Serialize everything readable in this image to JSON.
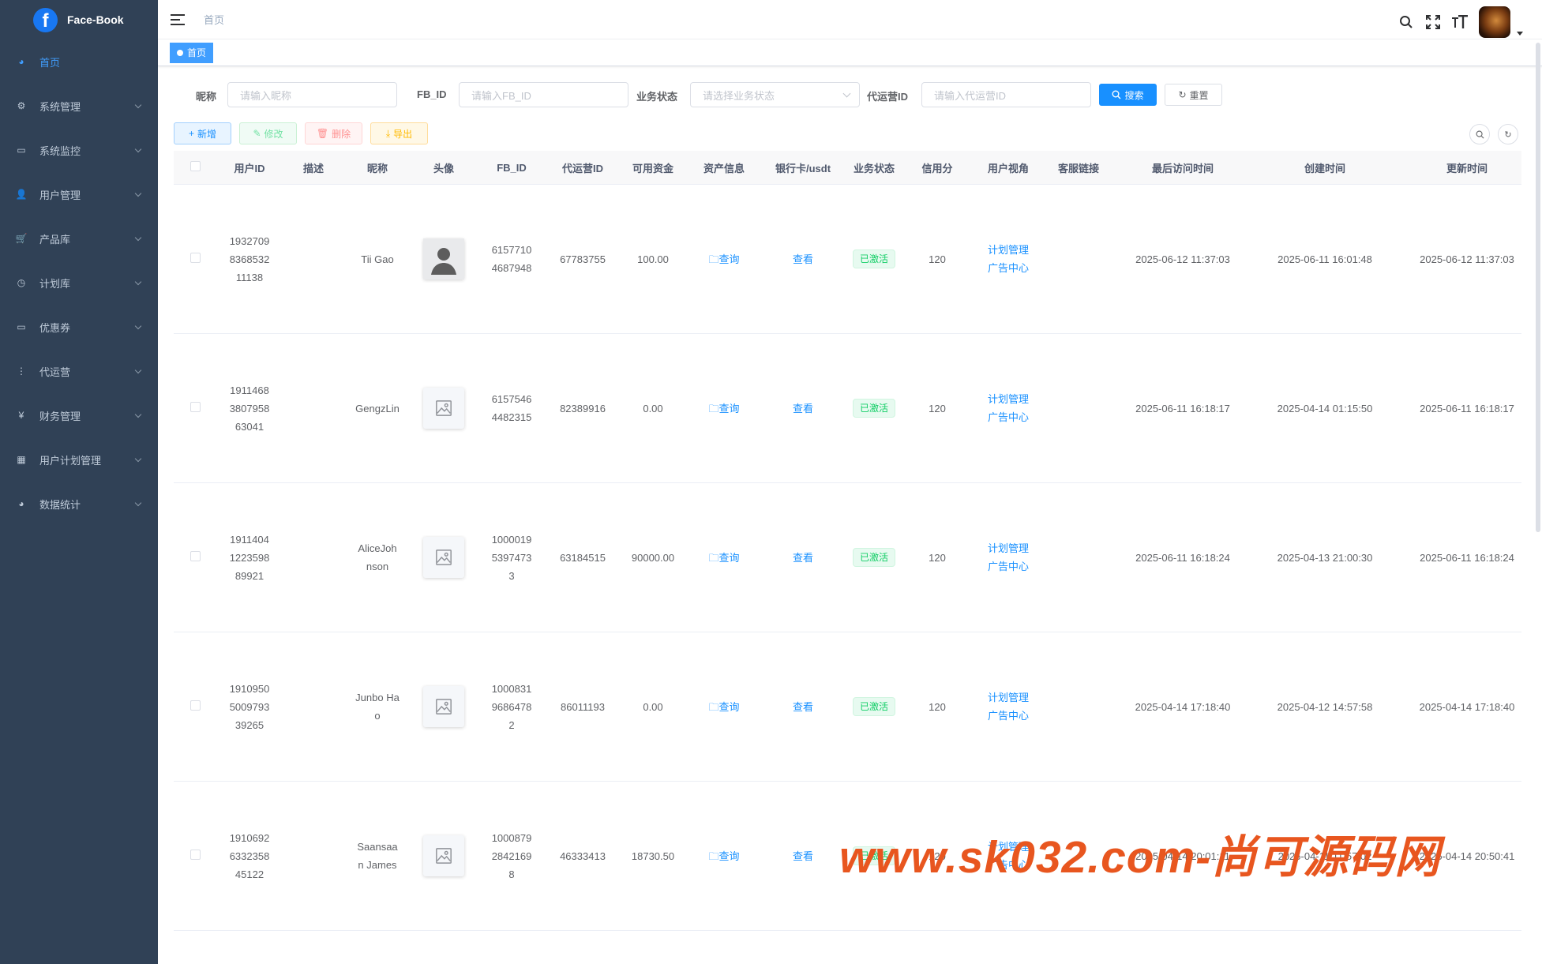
{
  "brand": {
    "title": "Face-Book",
    "logo_letter": "f",
    "accent": "#409eff"
  },
  "sidebar": {
    "items": [
      {
        "label": "首页",
        "icon": "dashboard-icon",
        "active": true
      },
      {
        "label": "系统管理",
        "icon": "gear-icon"
      },
      {
        "label": "系统监控",
        "icon": "monitor-icon"
      },
      {
        "label": "用户管理",
        "icon": "users-icon"
      },
      {
        "label": "产品库",
        "icon": "cart-icon"
      },
      {
        "label": "计划库",
        "icon": "clock-icon"
      },
      {
        "label": "优惠券",
        "icon": "coupon-icon"
      },
      {
        "label": "代运营",
        "icon": "tree-icon"
      },
      {
        "label": "财务管理",
        "icon": "yen-icon"
      },
      {
        "label": "用户计划管理",
        "icon": "grid-icon"
      },
      {
        "label": "数据统计",
        "icon": "chart-icon"
      }
    ]
  },
  "navbar": {
    "breadcrumb": "首页"
  },
  "tags": {
    "active_tag": "首页"
  },
  "search": {
    "nickname_label": "昵称",
    "nickname_placeholder": "请输入昵称",
    "fbid_label": "FB_ID",
    "fbid_placeholder": "请输入FB_ID",
    "status_label": "业务状态",
    "status_placeholder": "请选择业务状态",
    "agent_label": "代运营ID",
    "agent_placeholder": "请输入代运营ID",
    "search_button": "搜索",
    "reset_button": "重置"
  },
  "toolbar": {
    "add": "新增",
    "edit": "修改",
    "delete": "删除",
    "export": "导出"
  },
  "table": {
    "columns": [
      "",
      "用户ID",
      "描述",
      "昵称",
      "头像",
      "FB_ID",
      "代运营ID",
      "可用资金",
      "资产信息",
      "银行卡/usdt",
      "业务状态",
      "信用分",
      "用户视角",
      "客服链接",
      "最后访问时间",
      "创建时间",
      "更新时间"
    ],
    "rows": [
      {
        "user_id": [
          "1932709",
          "8368532",
          "11138"
        ],
        "desc": "",
        "nickname": [
          "Tii Gao"
        ],
        "avatar": "person",
        "fb_id": [
          "6157710",
          "4687948"
        ],
        "agent_id": "67783755",
        "funds": "100.00",
        "asset": "查询",
        "bank": "查看",
        "status": "已激活",
        "credit": "120",
        "view1": "计划管理",
        "view2": "广告中心",
        "service": "",
        "last_visit": "2025-06-12 11:37:03",
        "created": "2025-06-11 16:01:48",
        "updated": "2025-06-12 11:37:03"
      },
      {
        "user_id": [
          "1911468",
          "3807958",
          "63041"
        ],
        "desc": "",
        "nickname": [
          "GengzLin"
        ],
        "avatar": "image",
        "fb_id": [
          "6157546",
          "4482315"
        ],
        "agent_id": "82389916",
        "funds": "0.00",
        "asset": "查询",
        "bank": "查看",
        "status": "已激活",
        "credit": "120",
        "view1": "计划管理",
        "view2": "广告中心",
        "service": "",
        "last_visit": "2025-06-11 16:18:17",
        "created": "2025-04-14 01:15:50",
        "updated": "2025-06-11 16:18:17"
      },
      {
        "user_id": [
          "1911404",
          "1223598",
          "89921"
        ],
        "desc": "",
        "nickname": [
          "AliceJoh",
          "nson"
        ],
        "avatar": "image",
        "fb_id": [
          "1000019",
          "5397473",
          "3"
        ],
        "agent_id": "63184515",
        "funds": "90000.00",
        "asset": "查询",
        "bank": "查看",
        "status": "已激活",
        "credit": "120",
        "view1": "计划管理",
        "view2": "广告中心",
        "service": "",
        "last_visit": "2025-06-11 16:18:24",
        "created": "2025-04-13 21:00:30",
        "updated": "2025-06-11 16:18:24"
      },
      {
        "user_id": [
          "1910950",
          "5009793",
          "39265"
        ],
        "desc": "",
        "nickname": [
          "Junbo Ha",
          "o"
        ],
        "avatar": "image",
        "fb_id": [
          "1000831",
          "9686478",
          "2"
        ],
        "agent_id": "86011193",
        "funds": "0.00",
        "asset": "查询",
        "bank": "查看",
        "status": "已激活",
        "credit": "120",
        "view1": "计划管理",
        "view2": "广告中心",
        "service": "",
        "last_visit": "2025-04-14 17:18:40",
        "created": "2025-04-12 14:57:58",
        "updated": "2025-04-14 17:18:40"
      },
      {
        "user_id": [
          "1910692",
          "6332358",
          "45122"
        ],
        "desc": "",
        "nickname": [
          "Saansaa",
          "n James"
        ],
        "avatar": "image",
        "fb_id": [
          "1000879",
          "2842169",
          "8"
        ],
        "agent_id": "46333413",
        "funds": "18730.50",
        "asset": "查询",
        "bank": "查看",
        "status": "已激活",
        "credit": "120",
        "view1": "计划管理",
        "view2": "广告中心",
        "service": "",
        "last_visit": "2025-04-14 20:01:11",
        "created": "2025-04-11 11:57:02",
        "updated": "2025-04-14 20:50:41"
      }
    ]
  },
  "watermark": "www.sk032.com-尚可源码网"
}
